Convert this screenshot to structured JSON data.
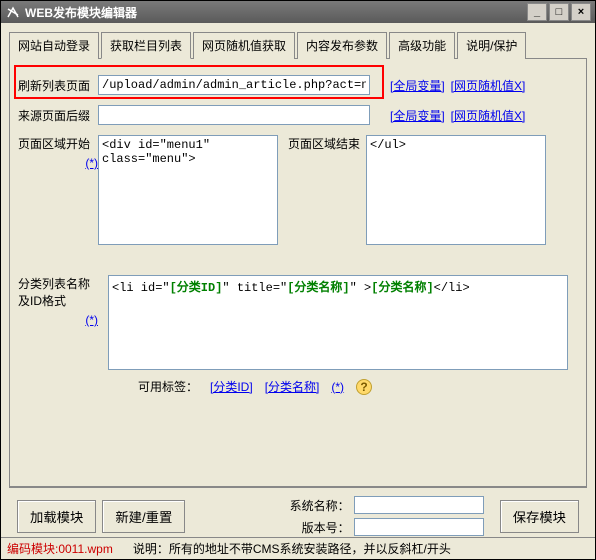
{
  "window": {
    "title": "WEB发布模块编辑器"
  },
  "tabs": {
    "items": [
      {
        "label": "网站自动登录"
      },
      {
        "label": "获取栏目列表"
      },
      {
        "label": "网页随机值获取"
      },
      {
        "label": "内容发布参数"
      },
      {
        "label": "高级功能"
      },
      {
        "label": "说明/保护"
      }
    ],
    "active_index": 1
  },
  "form": {
    "refresh_label": "刷新列表页面",
    "refresh_value": "/upload/admin/admin_article.php?act=news_add",
    "global_var_link": "[全局变量]",
    "random_x_link": "[网页随机值X]",
    "source_suffix_label": "来源页面后缀",
    "source_suffix_value": "",
    "area_start_label": "页面区域开始",
    "area_start_value": "<div id=\"menu1\"\nclass=\"menu\">",
    "area_end_label": "页面区域结束",
    "area_end_value": "</ul>",
    "asterisk": "(*)",
    "format_label": "分类列表名称及ID格式",
    "format_prefix": "<li id=\"",
    "format_token1": "[分类ID]",
    "format_mid": "\" title=\"",
    "format_token2": "[分类名称]",
    "format_gt": "\" >",
    "format_token3": "[分类名称]",
    "format_suffix": "</li>",
    "tags_label": "可用标签：",
    "tag1": "[分类ID]",
    "tag2": "[分类名称]",
    "tag_ast": "(*)"
  },
  "bottom": {
    "load_module": "加载模块",
    "new_reset": "新建/重置",
    "sys_name_label": "系统名称：",
    "sys_name_value": "",
    "version_label": "版本号：",
    "version_value": "",
    "save_module": "保存模块"
  },
  "status": {
    "left": "编码模块:0011.wpm",
    "right": "说明：所有的地址不带CMS系统安装路径，并以反斜杠/开头"
  }
}
